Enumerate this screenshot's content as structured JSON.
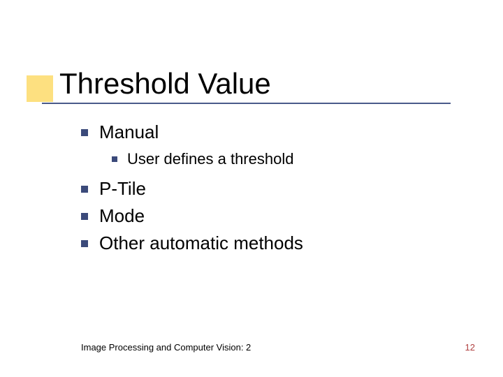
{
  "title": "Threshold Value",
  "items": [
    {
      "text": "Manual",
      "level": 1
    },
    {
      "text": "User defines a threshold",
      "level": 2
    },
    {
      "text": "P-Tile",
      "level": 1
    },
    {
      "text": "Mode",
      "level": 1
    },
    {
      "text": "Other automatic methods",
      "level": 1
    }
  ],
  "footer": {
    "left": "Image Processing and Computer Vision: 2",
    "right": "12"
  }
}
